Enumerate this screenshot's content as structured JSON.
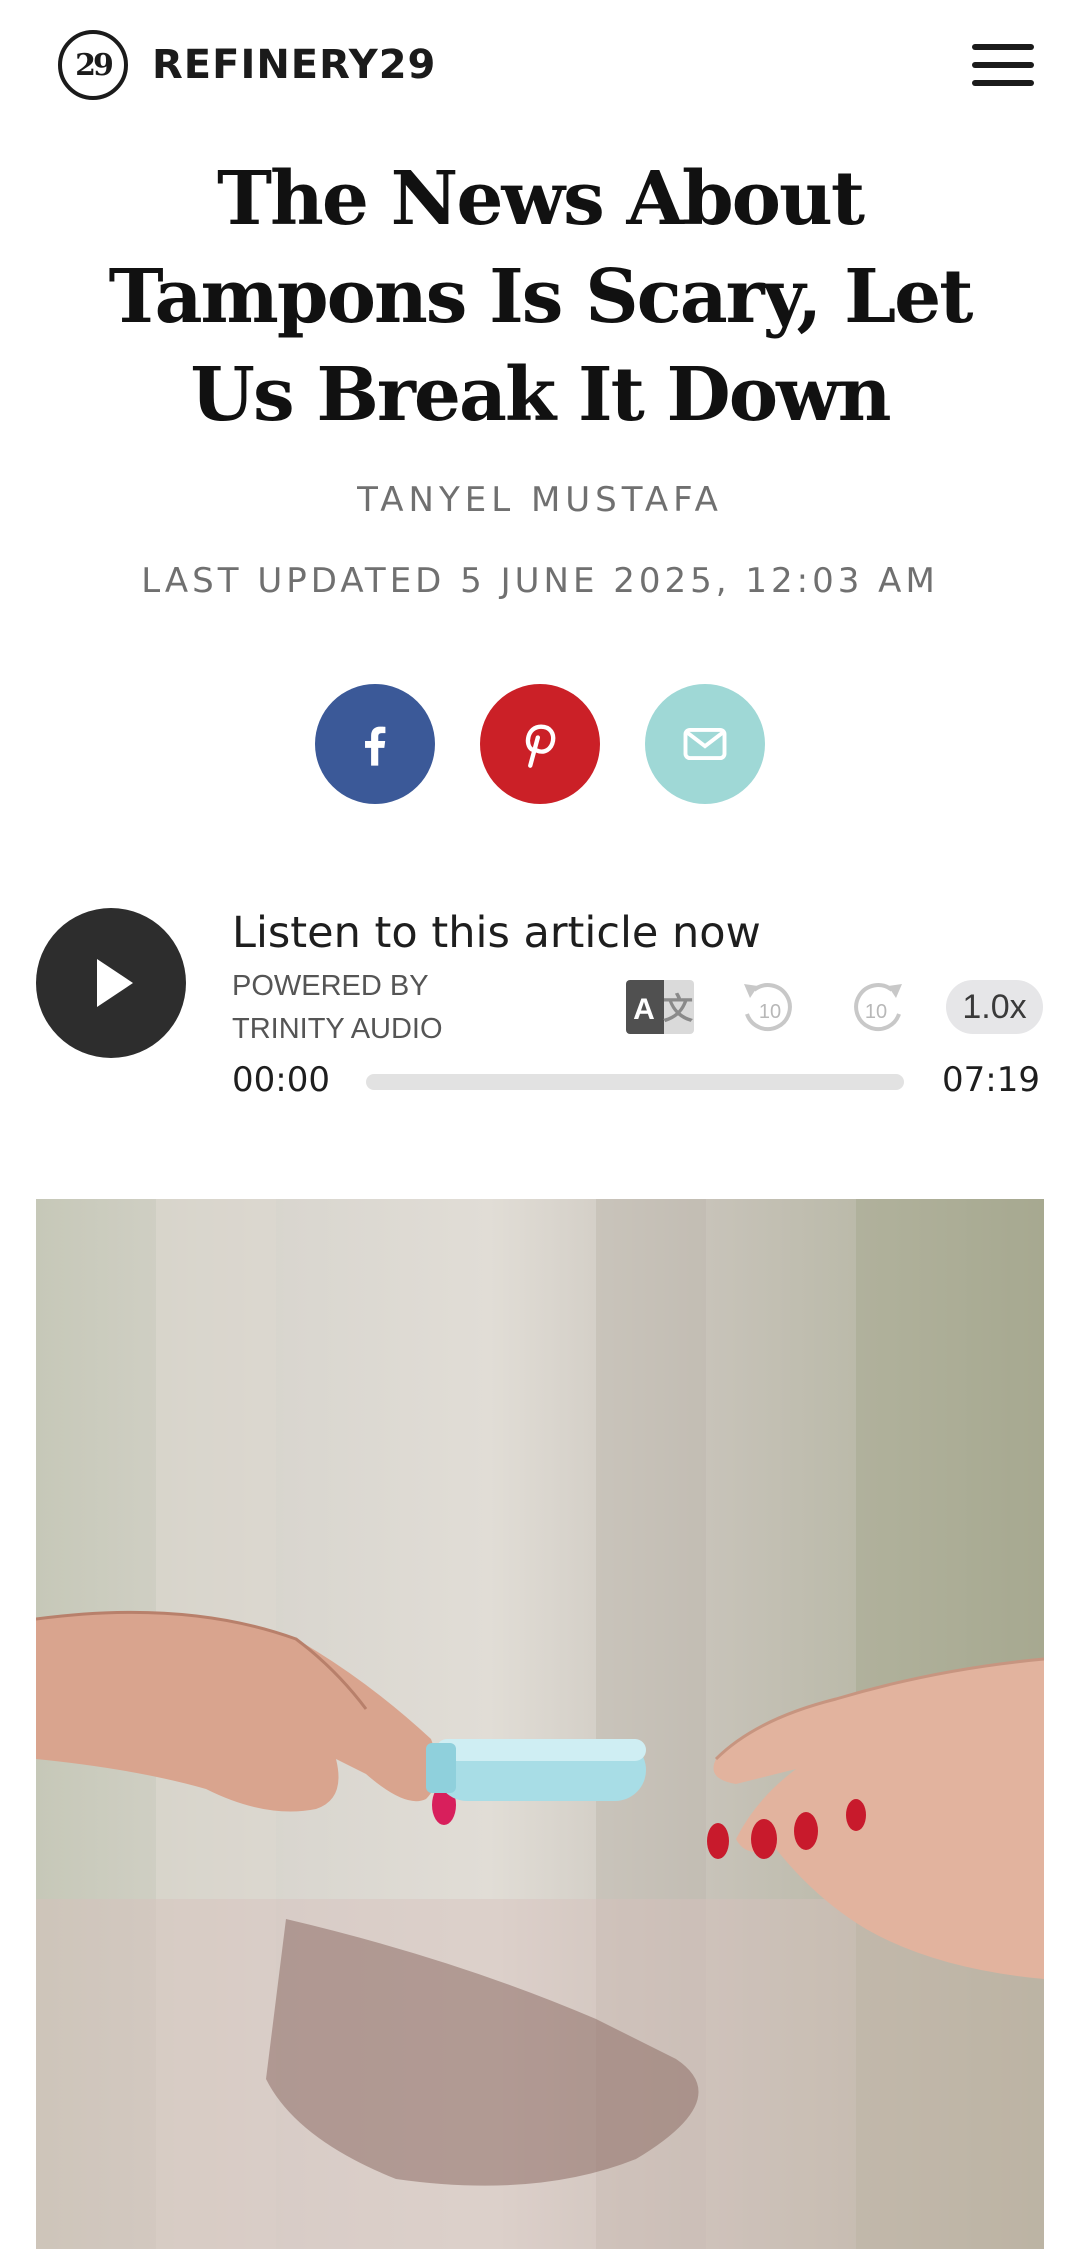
{
  "header": {
    "logo_mark": "29",
    "logo_text": "REFINERY29",
    "menu_icon": "hamburger-menu-icon"
  },
  "article": {
    "title": "The News About Tampons Is Scary, Let Us Break It Down",
    "author": "TANYEL MUSTAFA",
    "updated": "LAST UPDATED 5 JUNE 2025, 12:03 AM"
  },
  "share": {
    "facebook": {
      "icon": "facebook-icon",
      "color": "#3b5998"
    },
    "pinterest": {
      "icon": "pinterest-icon",
      "color": "#cb2027"
    },
    "email": {
      "icon": "mail-icon",
      "color": "#9fd8d6"
    }
  },
  "audio": {
    "title": "Listen to this article now",
    "powered_by_line1": "POWERED BY",
    "powered_by_line2": "TRINITY AUDIO",
    "translate_icon": "translate-icon",
    "rewind_label": "10",
    "forward_label": "10",
    "speed": "1.0x",
    "current_time": "00:00",
    "duration": "07:19",
    "progress": 0
  },
  "hero": {
    "description_icon": "hero-photo"
  }
}
